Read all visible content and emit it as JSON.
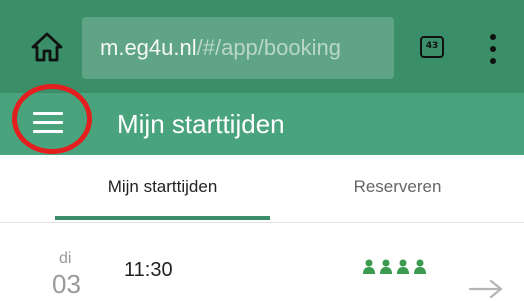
{
  "browser": {
    "url_host": "m.eg4u.nl",
    "url_path": "/#/app/booking",
    "tab_count": "43",
    "icons": {
      "home": "home-icon",
      "tabs": "tabs-icon",
      "more": "more-vert-icon"
    }
  },
  "app_header": {
    "title": "Mijn starttijden",
    "menu_icon": "hamburger-menu-icon",
    "highlight_color": "#e3201f"
  },
  "tabs": [
    {
      "label": "Mijn starttijden",
      "active": true
    },
    {
      "label": "Reserveren",
      "active": false
    }
  ],
  "bookings": [
    {
      "day_name": "di",
      "day_number": "03",
      "time": "11:30",
      "player_count": 4,
      "action_icon": "arrow-right-icon"
    }
  ],
  "colors": {
    "browser_bar": "#3a8f68",
    "app_header": "#49a37d",
    "accent": "#3a8f68",
    "highlight": "#e3201f"
  }
}
